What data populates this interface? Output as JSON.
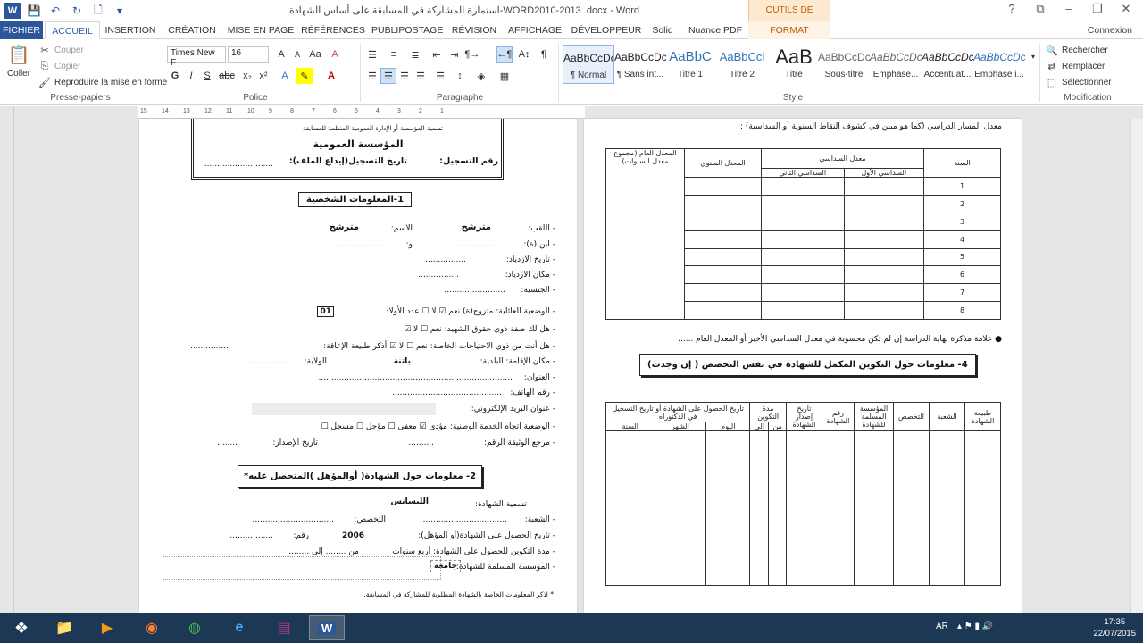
{
  "window": {
    "title": "استمارة المشاركة في المسابقة على أساس الشهادة-WORD2010-2013 .docx - Word",
    "context_label": "OUTILS DE DESSIN"
  },
  "tabs": [
    "FICHIER",
    "ACCUEIL",
    "INSERTION",
    "CRÉATION",
    "MISE EN PAGE",
    "RÉFÉRENCES",
    "PUBLIPOSTAGE",
    "RÉVISION",
    "AFFICHAGE",
    "DÉVELOPPEUR",
    "Solid",
    "Nuance PDF",
    "FORMAT"
  ],
  "account": "Connexion",
  "clipboard": {
    "paste": "Coller",
    "cut": "Couper",
    "copy": "Copier",
    "format_painter": "Reproduire la mise en forme",
    "label": "Presse-papiers"
  },
  "font": {
    "name": "Times New F",
    "size": "16",
    "label": "Police"
  },
  "paragraph": {
    "label": "Paragraphe"
  },
  "styles": {
    "label": "Style",
    "items": [
      {
        "sample": "AaBbCcDc",
        "name": "¶ Normal"
      },
      {
        "sample": "AaBbCcDc",
        "name": "¶ Sans int..."
      },
      {
        "sample": "AaBbC",
        "name": "Titre 1"
      },
      {
        "sample": "AaBbCcl",
        "name": "Titre 2"
      },
      {
        "sample": "AaB",
        "name": "Titre"
      },
      {
        "sample": "AaBbCcDc",
        "name": "Sous-titre"
      },
      {
        "sample": "AaBbCcDc",
        "name": "Emphase..."
      },
      {
        "sample": "AaBbCcDc",
        "name": "Accentuat..."
      },
      {
        "sample": "AaBbCcDc",
        "name": "Emphase i..."
      }
    ]
  },
  "editing": {
    "find": "Rechercher",
    "replace": "Remplacer",
    "select": "Sélectionner",
    "label": "Modification"
  },
  "ruler": [
    "15",
    "14",
    "13",
    "12",
    "11",
    "10",
    "9",
    "8",
    "7",
    "6",
    "5",
    "4",
    "3",
    "2",
    "1"
  ],
  "page1": {
    "header_line1": "تسمية المؤسسة أو الإدارة العمومية المنظمة للمسابقة",
    "org_title": "المؤسسة العمومية",
    "reg_number": "رقم التسجيل:",
    "reg_date": "تاريخ التسجيل(إيداع الملف):",
    "section1": "1-المعلومات الشخصية",
    "fields": [
      {
        "label": "- اللقب:",
        "value": "مترشح",
        "label2": "الاسم:",
        "value2": "مترشح"
      },
      {
        "label": "- ابن (ة):",
        "value": "...............",
        "label2": "و:",
        "value2": "..................."
      },
      {
        "label": "- تاريخ الازدياد:",
        "value": "................"
      },
      {
        "label": "- مكان الازدياد:",
        "value": "................"
      },
      {
        "label": "- الجنسية:",
        "value": "........................"
      },
      {
        "label": "- الوضعية العائلية: متزوج(ة) نعم ☑ لا ☐ عدد الأولاد",
        "value": "01"
      },
      {
        "label": "- هل لك صفة ذوي حقوق الشهيد: نعم ☐ لا ☑"
      },
      {
        "label": "- هل أنت من ذوي الاحتياجات الخاصة: نعم ☐ لا ☑ أذكر طبيعة الإعاقة:",
        "value": "..............."
      },
      {
        "label": "- مكان الإقامة: البلدية:",
        "value": "باتنة",
        "label2": "الولاية:",
        "value2": "................"
      },
      {
        "label": "- العنوان:",
        "value": "............................................................................"
      },
      {
        "label": "- رقم الهاتف:",
        "value": "..........................................."
      },
      {
        "label": "- عنوان البريد الإلكتروني:",
        "value": ""
      },
      {
        "label": "- الوضعية اتجاه الخدمة الوطنية: مؤدى ☑ معفى ☐ مؤجل ☐ مسجل ☐"
      },
      {
        "label": "- مرجع الوثيقة الرقم:",
        "value": "..........",
        "label2": "تاريخ الإصدار:",
        "value2": "........"
      }
    ],
    "section2": "2- معلومات حول الشهادة( أوالمؤهل )المتحصل عليه*",
    "fields2": [
      {
        "label": "تسمية الشهادة:",
        "value": "الليسانس"
      },
      {
        "label": "- الشعبة:",
        "value": ".................................",
        "label2": "التخصص:",
        "value2": "................................"
      },
      {
        "label": "- تاريخ الحصول على الشهادة(أو المؤهل):",
        "value": "2006",
        "label2": "رقم:",
        "value2": "................."
      },
      {
        "label": "- مدة التكوين للحصول على الشهادة: أربع سنوات",
        "value": "من ........ إلى ........"
      },
      {
        "label": "- المؤسسة المسلمة للشهادة:",
        "value": "جامعة"
      }
    ],
    "footnote": "* اذكر المعلومات الخاصة بالشهادة المطلوبة للمشاركة في المسابقة."
  },
  "page2": {
    "intro": "معدل المسار الدراسي (كما هو مبين في كشوف النقاط السنوية أو السداسية) :",
    "table1_headers": {
      "year": "السنة",
      "semester_avg": "معدل السداسي",
      "sem1": "السداسي الأول",
      "sem2": "السداسي الثاني",
      "annual": "المعدل السنوي",
      "general": "المعدل العام (مجموع معدل السنوات)"
    },
    "years": [
      "1",
      "2",
      "3",
      "4",
      "5",
      "6",
      "7",
      "8"
    ],
    "bullet": "علامة مذكرة نهاية الدراسة إن لم تكن محسوبة في معدل السداسي الأخير أو المعدل العام ......",
    "section4": "4- معلومات حول التكوين المكمل للشهادة في نفس التخصص ( إن وجدت)",
    "table2_headers": {
      "nature": "طبيعة الشهادة",
      "branch": "الشعبة",
      "specialty": "التخصص",
      "institution": "المؤسسة المسلمة للشهادة",
      "number": "رقم الشهادة",
      "issue_date": "تاريخ إصدار الشهادة",
      "duration": "مدة التكوين",
      "from": "من",
      "to": "إلى",
      "obtained": "تاريخ الحصول على الشهادة أو تاريخ التسجيل في الدكتوراه",
      "day": "اليوم",
      "month": "الشهر",
      "year": "السنة"
    }
  },
  "taskbar": {
    "items": [
      "start",
      "explorer",
      "media",
      "firefox",
      "chrome",
      "ie",
      "winrar",
      "word"
    ],
    "lang": "AR",
    "time": "17:35",
    "date": "22/07/2015"
  }
}
